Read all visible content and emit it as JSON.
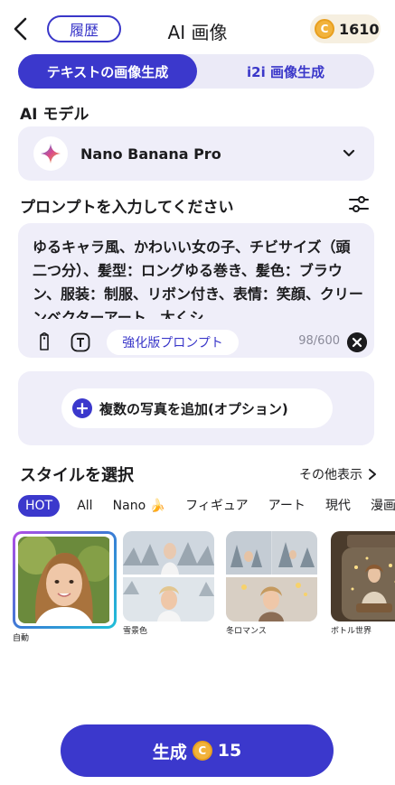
{
  "header": {
    "title": "AI 画像",
    "history_label": "履歴",
    "credits": "1610",
    "coin_symbol": "C"
  },
  "mode_tabs": [
    {
      "label": "テキストの画像生成",
      "active": true
    },
    {
      "label": "i2i 画像生成",
      "active": false
    }
  ],
  "model_section": {
    "label": "AI モデル",
    "selected_model": "Nano Banana Pro"
  },
  "prompt_section": {
    "label": "プロンプトを入力してください",
    "text": "ゆるキャラ風、かわいい女の子、チビサイズ（頭二つ分）、髪型：ロングゆる巻き、髪色：ブラウン、服装：制服、リボン付き、表情：笑顔、クリーンベクターアート、太くシ",
    "enhance_label": "強化版プロンプト",
    "char_count": "98/600"
  },
  "add_photo": {
    "label": "複数の写真を追加(オプション)"
  },
  "styles": {
    "title": "スタイルを選択",
    "more_label": "その他表示",
    "tabs": [
      "HOT",
      "All",
      "Nano 🍌",
      "フィギュア",
      "アート",
      "現代",
      "漫画"
    ],
    "active_tab": "HOT",
    "items": [
      {
        "name": "自動",
        "selected": true
      },
      {
        "name": "雪景色",
        "selected": false
      },
      {
        "name": "冬ロマンス",
        "selected": false
      },
      {
        "name": "ボトル世界",
        "selected": false
      }
    ]
  },
  "generate": {
    "label": "生成",
    "cost": "15"
  },
  "colors": {
    "accent": "#3b38cc",
    "panel": "#efeef9",
    "coin": "#f2b33c"
  }
}
